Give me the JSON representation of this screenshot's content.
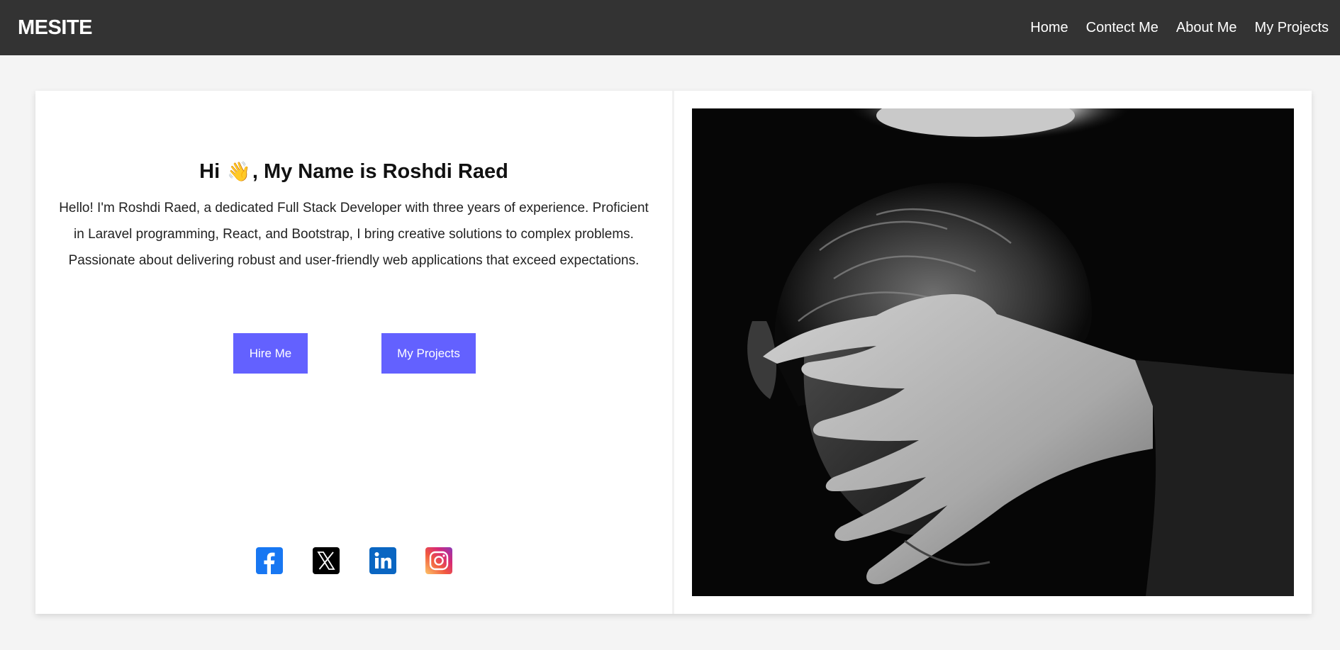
{
  "navbar": {
    "brand": "MESITE",
    "links": [
      "Home",
      "Contect Me",
      "About Me",
      "My Projects"
    ]
  },
  "hero": {
    "greeting_prefix": "Hi",
    "greeting_emoji": "👋",
    "greeting_suffix": ", My Name is Roshdi Raed",
    "intro": "Hello! I'm Roshdi Raed, a dedicated Full Stack Developer with three years of experience. Proficient in Laravel programming, React, and Bootstrap, I bring creative solutions to complex problems. Passionate about delivering robust and user-friendly web applications that exceed expectations.",
    "buttons": {
      "hire": "Hire Me",
      "projects": "My Projects"
    },
    "social": [
      {
        "name": "facebook-icon",
        "color": "#1877f2"
      },
      {
        "name": "x-icon",
        "color": "#000000"
      },
      {
        "name": "linkedin-icon",
        "color": "#0a66c2"
      },
      {
        "name": "instagram-icon",
        "color": "#e1306c"
      }
    ]
  },
  "photo": {
    "subject": "portrait-photo"
  },
  "colors": {
    "navbar": "#333333",
    "accent": "#6361ff",
    "page_bg": "#f4f4f4"
  }
}
